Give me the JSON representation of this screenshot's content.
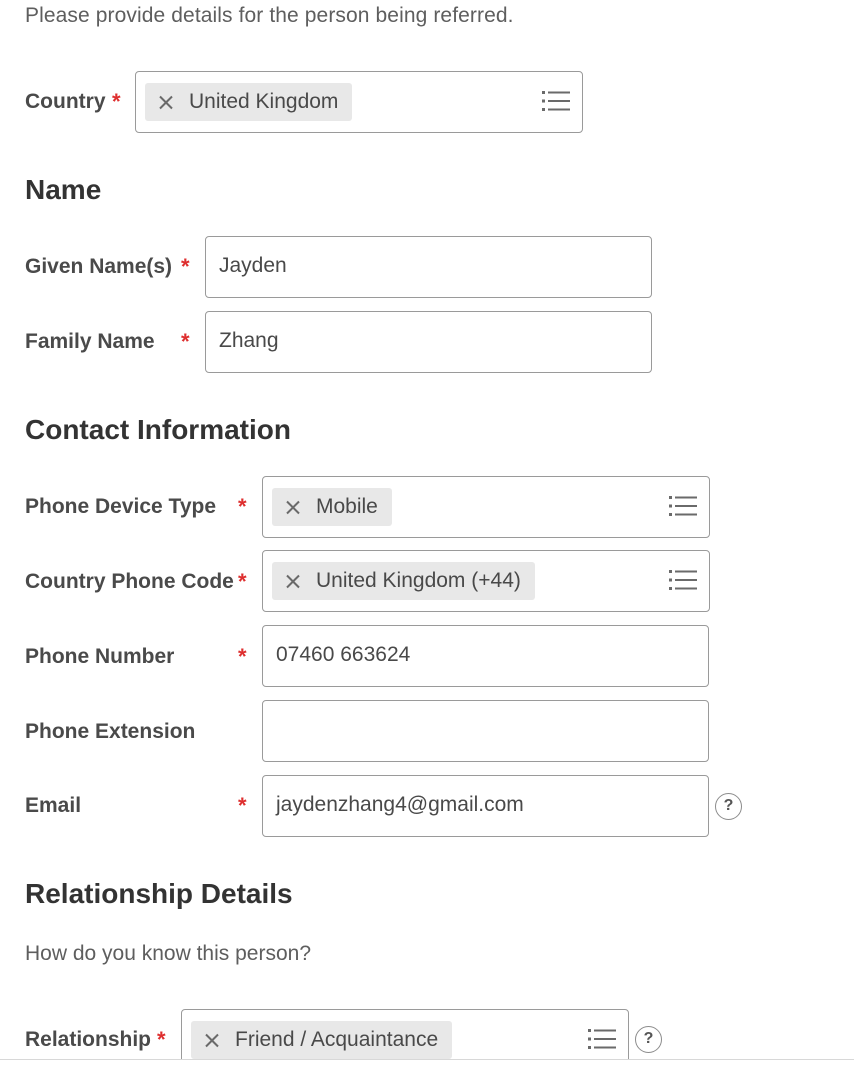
{
  "intro_text": "Please provide details for the person being referred.",
  "country": {
    "label": "Country",
    "value": "United Kingdom"
  },
  "name_section": {
    "title": "Name",
    "given": {
      "label": "Given Name(s)",
      "value": "Jayden"
    },
    "family": {
      "label": "Family Name",
      "value": "Zhang"
    }
  },
  "contact_section": {
    "title": "Contact Information",
    "device_type": {
      "label": "Phone Device Type",
      "value": "Mobile"
    },
    "country_code": {
      "label": "Country Phone Code",
      "value": "United Kingdom (+44)"
    },
    "phone_number": {
      "label": "Phone Number",
      "value": "07460 663624"
    },
    "phone_extension": {
      "label": "Phone Extension",
      "value": ""
    },
    "email": {
      "label": "Email",
      "value": "jaydenzhang4@gmail.com"
    }
  },
  "relationship_section": {
    "title": "Relationship Details",
    "question": "How do you know this person?",
    "relationship": {
      "label": "Relationship",
      "value": "Friend / Acquaintance"
    }
  },
  "required_marker": "*",
  "help_glyph": "?",
  "colors": {
    "required": "#de2f2f",
    "pill_bg": "#e8e8e8",
    "border": "#9a9a9a"
  }
}
